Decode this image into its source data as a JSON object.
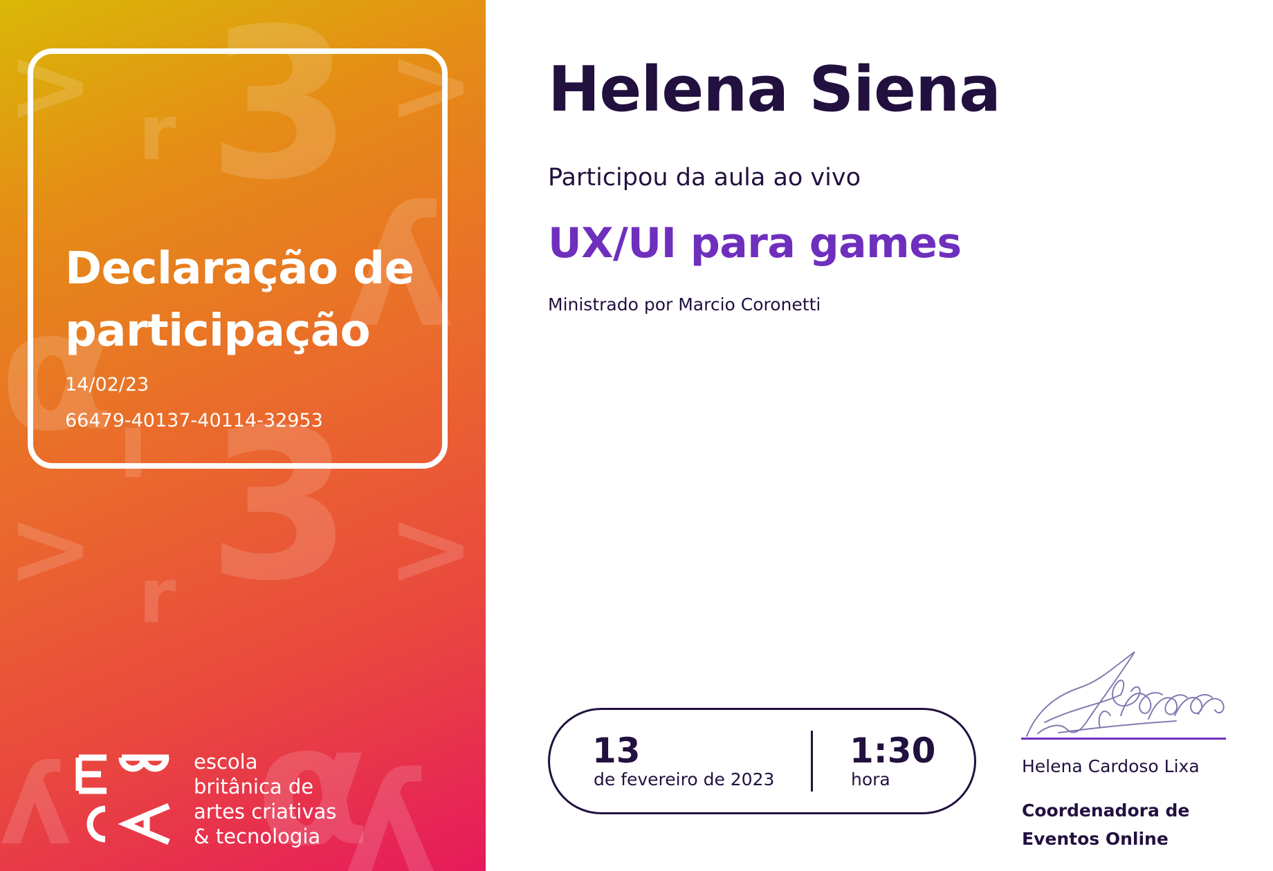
{
  "left_panel": {
    "title_line1": "Declaração de",
    "title_line2": "participação",
    "date": "14/02/23",
    "code": "66479-40137-40114-32953",
    "logo": {
      "line1": "escola",
      "line2": "britânica de",
      "line3": "artes criativas",
      "line4": "& tecnologia"
    }
  },
  "certificate": {
    "participant_name": "Helena Siena",
    "attended_text": "Participou da aula ao vivo",
    "course_title": "UX/UI para games",
    "instructor_text": "Ministrado por Marcio Coronetti"
  },
  "event": {
    "day": "13",
    "month_year": "de fevereiro de 2023",
    "duration": "1:30",
    "duration_label": "hora"
  },
  "signatory": {
    "name": "Helena Cardoso Lixa",
    "role_line1": "Coordenadora de",
    "role_line2": "Eventos Online"
  },
  "colors": {
    "dark_text": "#22103f",
    "accent_purple": "#6f2fbd",
    "gradient_top": "#d9b807",
    "gradient_bottom": "#e61a5c"
  }
}
